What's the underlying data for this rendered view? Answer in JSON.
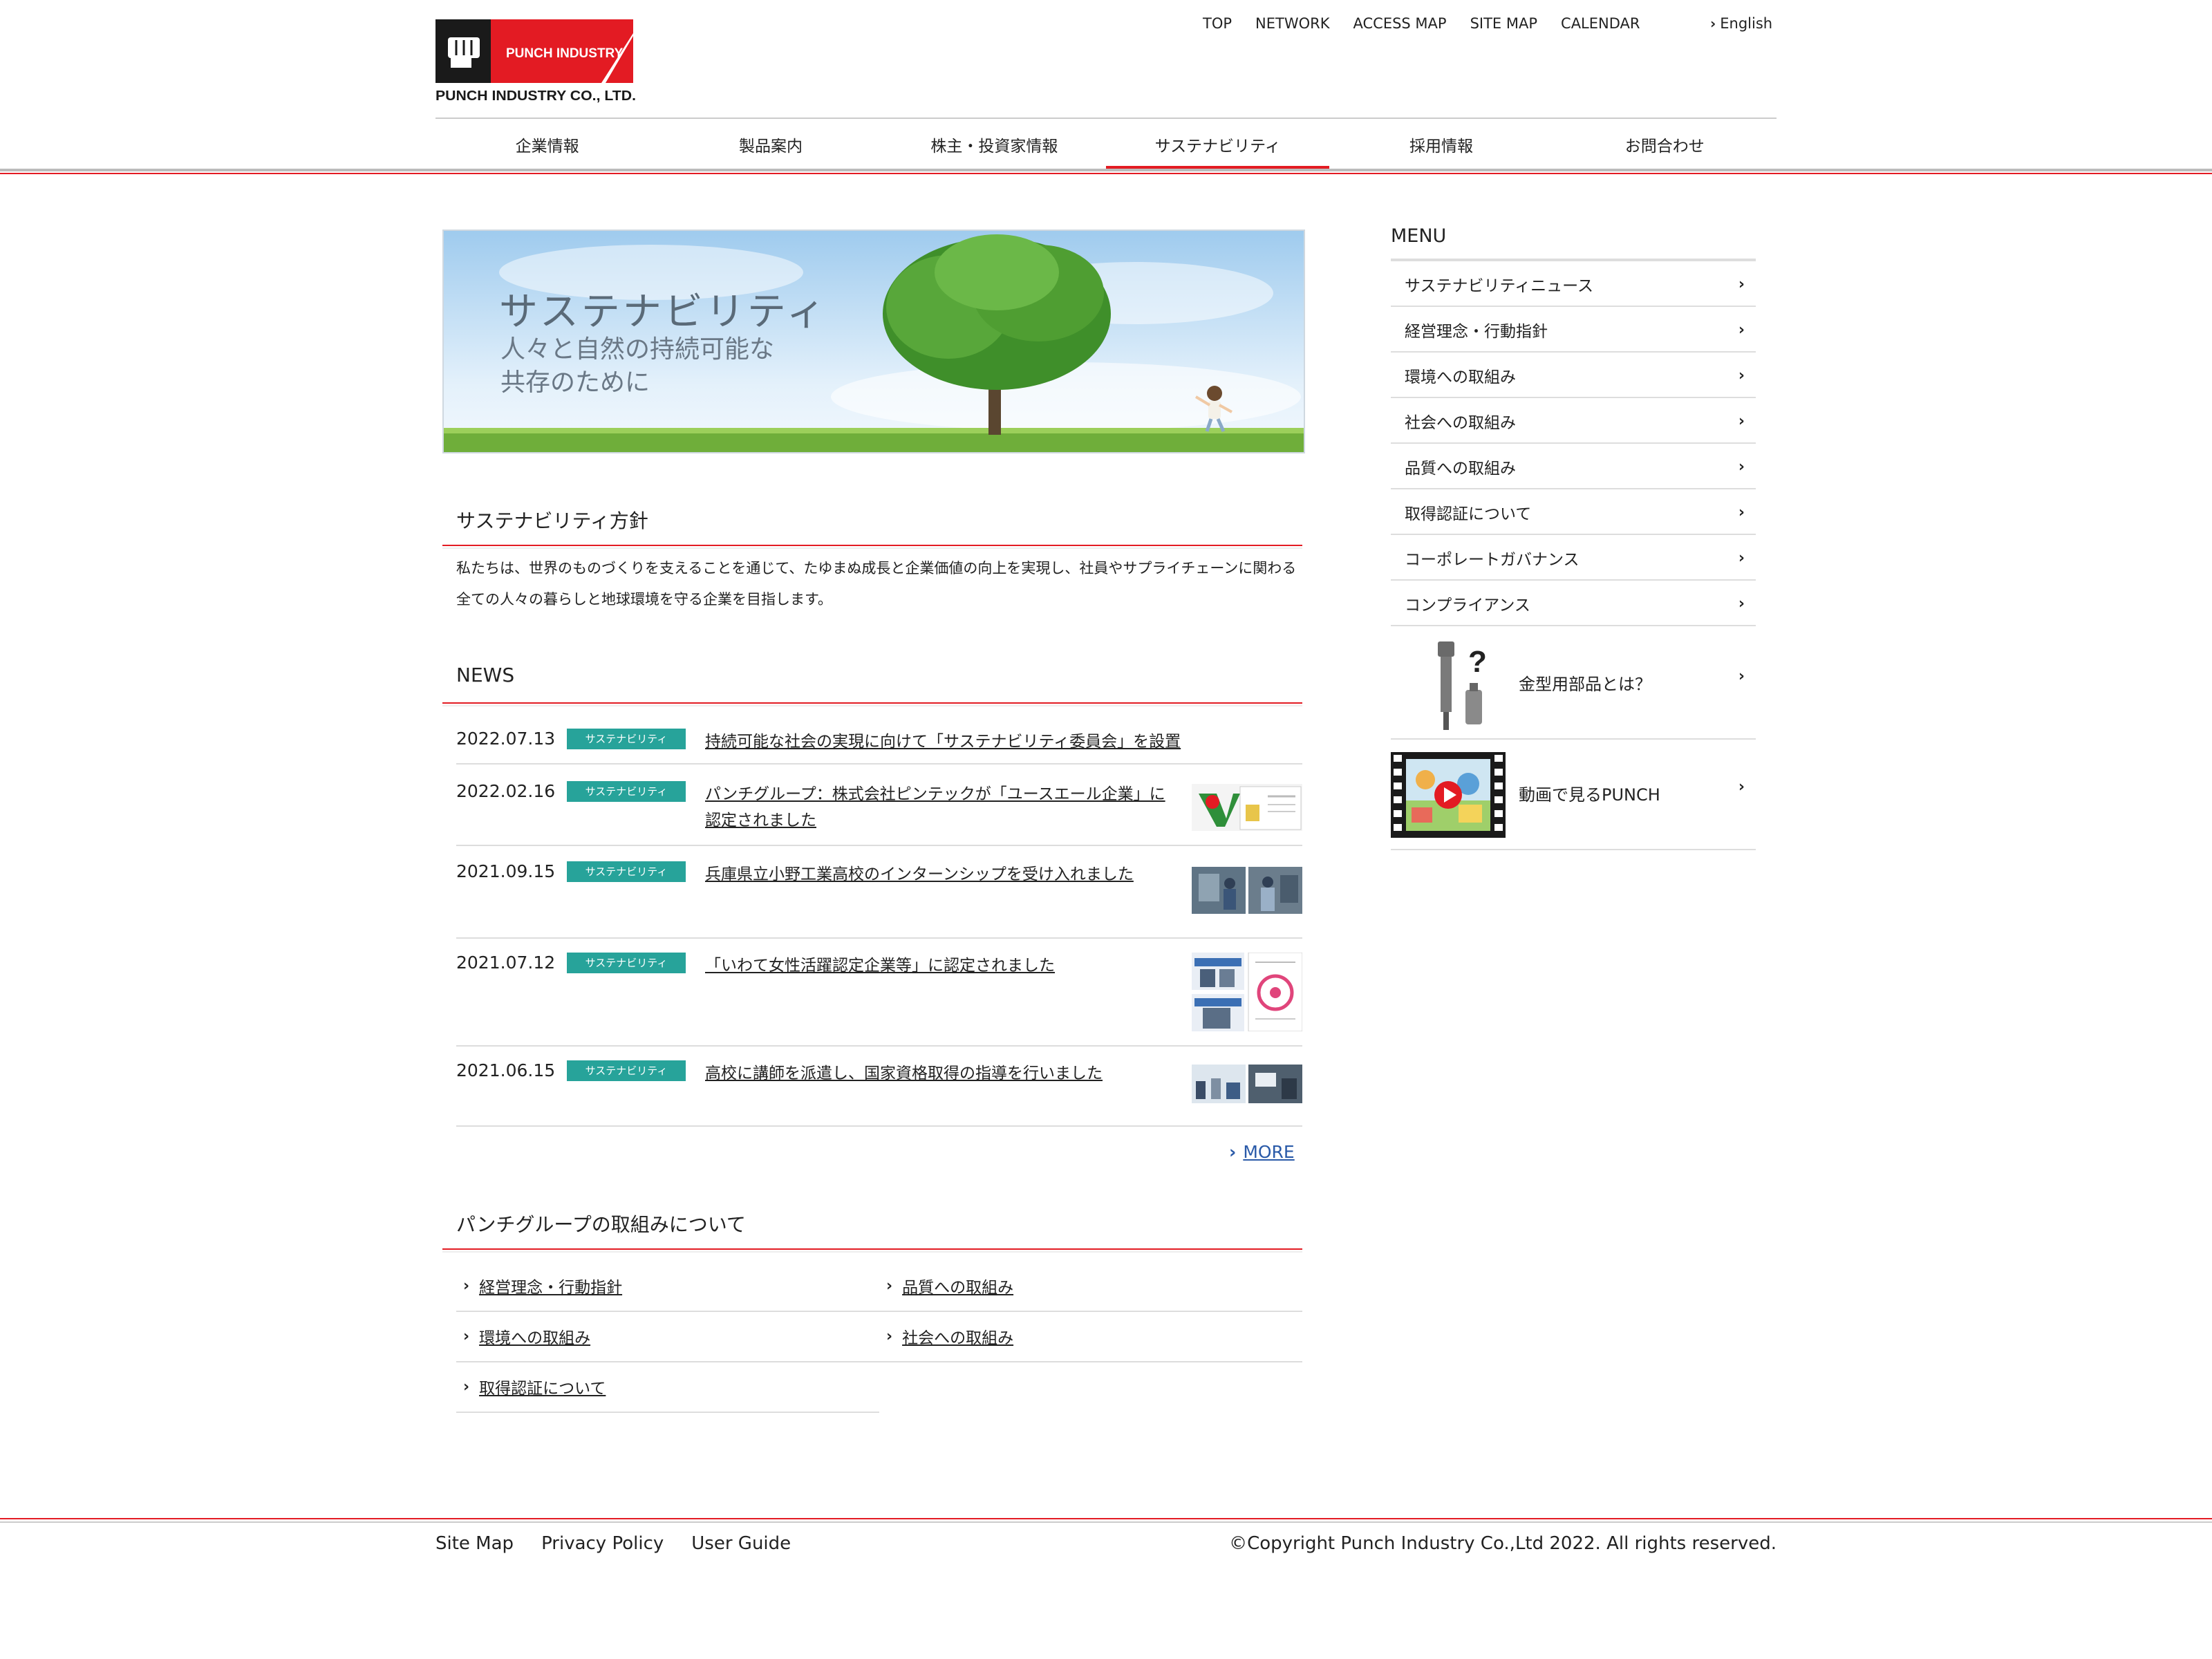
{
  "header": {
    "logo_top_text": "PUNCH INDUSTRY",
    "logo_bottom_text": "PUNCH INDUSTRY CO., LTD.",
    "top_links": [
      "TOP",
      "NETWORK",
      "ACCESS MAP",
      "SITE MAP",
      "CALENDAR"
    ],
    "english_label": "English"
  },
  "main_nav": [
    {
      "label": "企業情報"
    },
    {
      "label": "製品案内"
    },
    {
      "label": "株主・投資家情報"
    },
    {
      "label": "サステナビリティ",
      "active": true
    },
    {
      "label": "採用情報"
    },
    {
      "label": "お問合わせ"
    }
  ],
  "hero": {
    "title": "サステナビリティ",
    "subtitle_line1": "人々と自然の持続可能な",
    "subtitle_line2": "共存のために"
  },
  "policy": {
    "heading": "サステナビリティ方針",
    "text": "私たちは、世界のものづくりを支えることを通じて、たゆまぬ成長と企業価値の向上を実現し、社員やサプライチェーンに関わる全ての人々の暮らしと地球環境を守る企業を目指します。"
  },
  "news": {
    "heading": "NEWS",
    "items": [
      {
        "date": "2022.07.13",
        "badge": "サステナビリティ",
        "title": "持続可能な社会の実現に向けて「サステナビリティ委員会」を設置"
      },
      {
        "date": "2022.02.16",
        "badge": "サステナビリティ",
        "title": "パンチグループ：株式会社ピンテックが「ユースエール企業」に認定されました"
      },
      {
        "date": "2021.09.15",
        "badge": "サステナビリティ",
        "title": "兵庫県立小野工業高校のインターンシップを受け入れました"
      },
      {
        "date": "2021.07.12",
        "badge": "サステナビリティ",
        "title": "「いわて女性活躍認定企業等」に認定されました"
      },
      {
        "date": "2021.06.15",
        "badge": "サステナビリティ",
        "title": "高校に講師を派遣し、国家資格取得の指導を行いました"
      }
    ],
    "more_label": "MORE"
  },
  "group": {
    "heading": "パンチグループの取組みについて",
    "links": [
      "経営理念・行動指針",
      "品質への取組み",
      "環境への取組み",
      "社会への取組み",
      "取得認証について"
    ]
  },
  "sidebar": {
    "menu_heading": "MENU",
    "items": [
      "サステナビリティニュース",
      "経営理念・行動指針",
      "環境への取組み",
      "社会への取組み",
      "品質への取組み",
      "取得認証について",
      "コーポレートガバナンス",
      "コンプライアンス"
    ],
    "card1_label": "金型用部品とは？",
    "card2_label": "動画で見るPUNCH"
  },
  "footer": {
    "links": [
      "Site Map",
      "Privacy Policy",
      "User Guide"
    ],
    "copyright": "©Copyright Punch Industry Co.,Ltd 2022. All rights reserved."
  },
  "colors": {
    "accent_red": "#e31b23",
    "badge_teal": "#27a39a",
    "link_blue": "#2a5aa8"
  }
}
